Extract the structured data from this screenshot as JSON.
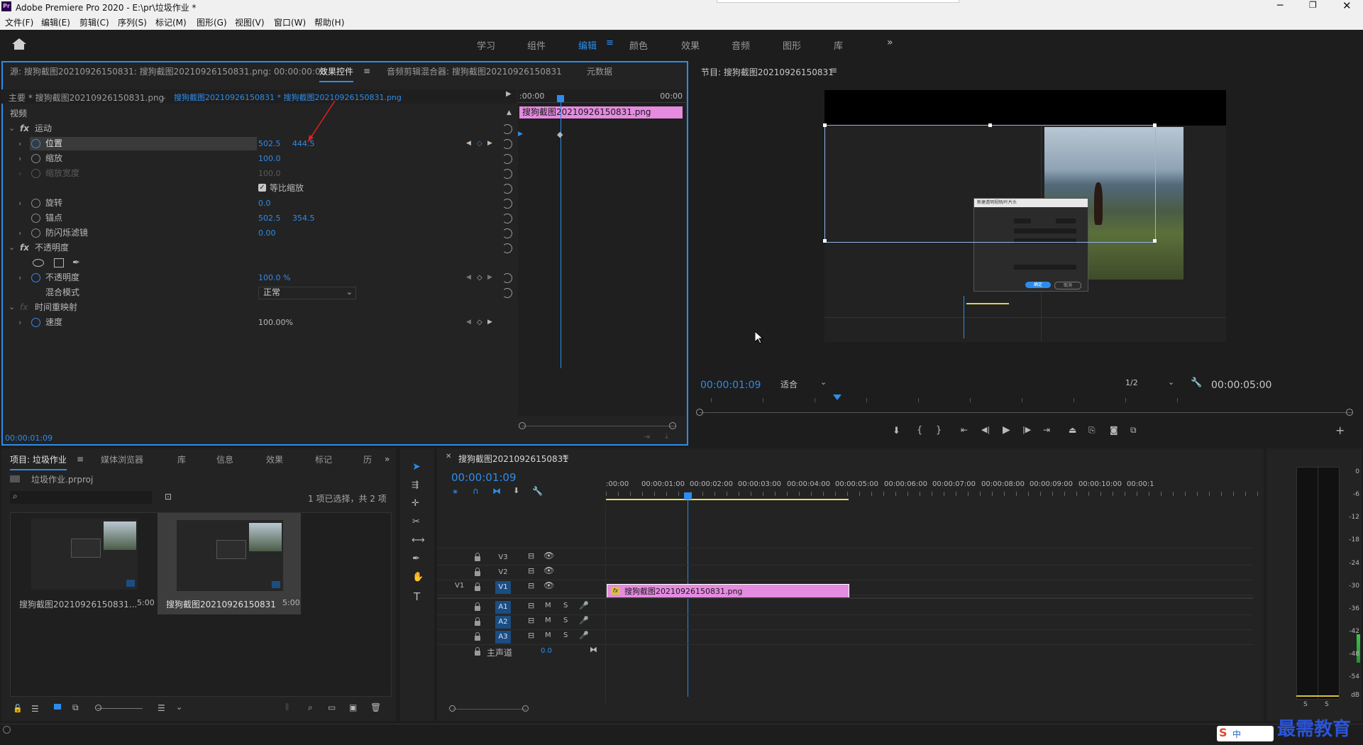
{
  "titlebar": {
    "app_title": "Adobe Premiere Pro 2020 - E:\\pr\\垃圾作业 *",
    "app_icon": "Pr"
  },
  "menu": [
    "文件(F)",
    "编辑(E)",
    "剪辑(C)",
    "序列(S)",
    "标记(M)",
    "图形(G)",
    "视图(V)",
    "窗口(W)",
    "帮助(H)"
  ],
  "workspaces": [
    "学习",
    "组件",
    "编辑",
    "颜色",
    "效果",
    "音频",
    "图形",
    "库"
  ],
  "workspace_active": "编辑",
  "effect_panel": {
    "tabs": [
      "源: 搜狗截图20210926150831: 搜狗截图20210926150831.png: 00:00:00:00",
      "效果控件",
      "音频剪辑混合器: 搜狗截图20210926150831",
      "元数据"
    ],
    "master": "主要 * 搜狗截图20210926150831.png",
    "clip_path": "搜狗截图20210926150831 * 搜狗截图20210926150831.png",
    "section_video": "视频",
    "motion": "运动",
    "position_label": "位置",
    "position_x": "502.5",
    "position_y": "444.5",
    "scale_label": "缩放",
    "scale_value": "100.0",
    "scale_width_label": "缩放宽度",
    "scale_width_value": "100.0",
    "uniform_label": "等比缩放",
    "rotation_label": "旋转",
    "rotation_value": "0.0",
    "anchor_label": "锚点",
    "anchor_x": "502.5",
    "anchor_y": "354.5",
    "flicker_label": "防闪烁滤镜",
    "flicker_value": "0.00",
    "opacity_section": "不透明度",
    "opacity_label": "不透明度",
    "opacity_value": "100.0 %",
    "blend_label": "混合模式",
    "blend_value": "正常",
    "time_remap": "时间重映射",
    "speed_label": "速度",
    "speed_value": "100.00%",
    "timecode": "00:00:01:09",
    "mini_ruler_start": ":00:00",
    "mini_ruler_end": "00:00",
    "mini_clip": "搜狗截图20210926150831.png"
  },
  "program": {
    "title": "节目: 搜狗截图20210926150831",
    "timecode": "00:00:01:09",
    "fit": "适合",
    "quality": "1/2",
    "duration": "00:00:05:00",
    "dialog_title": "新建透明视频/叶片头",
    "dialog_ok": "确定",
    "dialog_cancel": "取消"
  },
  "project": {
    "tabs": [
      "项目: 垃圾作业",
      "媒体浏览器",
      "库",
      "信息",
      "效果",
      "标记",
      "历"
    ],
    "file": "垃圾作业.prproj",
    "selection": "1 项已选择，共 2 项",
    "items": [
      {
        "name": "搜狗截图20210926150831...",
        "duration": "5:00"
      },
      {
        "name": "搜狗截图20210926150831",
        "duration": "5:00"
      }
    ]
  },
  "timeline": {
    "title": "搜狗截图20210926150831",
    "timecode": "00:00:01:09",
    "ruler": [
      ":00:00",
      "00:00:01:00",
      "00:00:02:00",
      "00:00:03:00",
      "00:00:04:00",
      "00:00:05:00",
      "00:00:06:00",
      "00:00:07:00",
      "00:00:08:00",
      "00:00:09:00",
      "00:00:10:00",
      "00:00:1"
    ],
    "video_tracks": [
      "V3",
      "V2",
      "V1"
    ],
    "audio_tracks": [
      "A1",
      "A2",
      "A3"
    ],
    "source_patch": "V1",
    "master_label": "主声道",
    "master_value": "0.0",
    "clip_name": "搜狗截图20210926150831.png",
    "m": "M",
    "s": "S"
  },
  "meter": {
    "labels": [
      "0",
      "-6",
      "-12",
      "-18",
      "-24",
      "-30",
      "-36",
      "-42",
      "-48",
      "-54",
      "dB"
    ],
    "solo": [
      "S",
      "S"
    ]
  },
  "watermark": "最需教育",
  "ime": "中",
  "colors": {
    "accent": "#2d8ceb",
    "clip": "#e58be0",
    "track_btn": "#1c4d80"
  }
}
